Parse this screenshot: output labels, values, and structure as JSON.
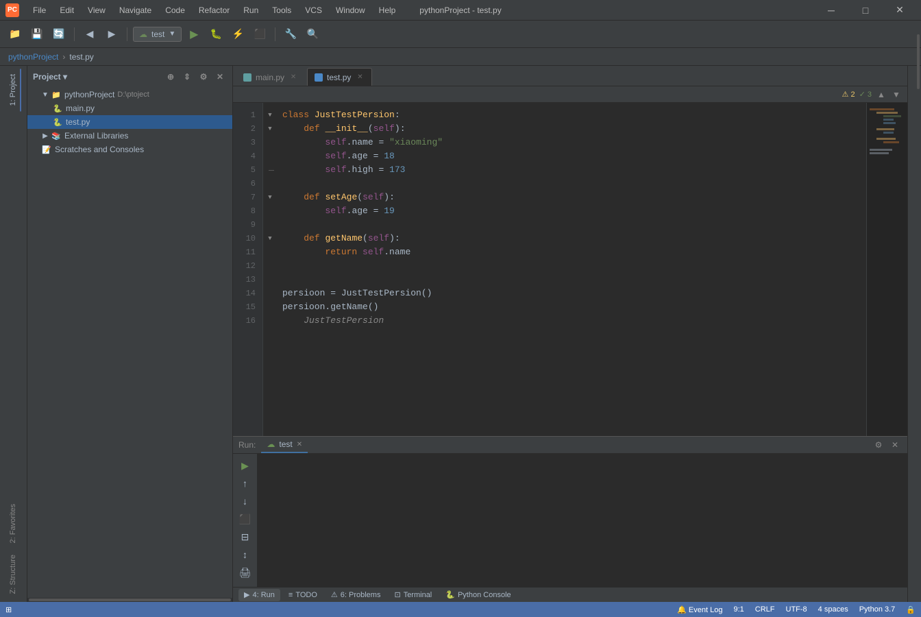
{
  "titleBar": {
    "logo": "PC",
    "title": "pythonProject - test.py",
    "menus": [
      "File",
      "Edit",
      "View",
      "Navigate",
      "Code",
      "Refactor",
      "Run",
      "Tools",
      "VCS",
      "Window",
      "Help"
    ],
    "minimize": "─",
    "maximize": "□",
    "close": "✕"
  },
  "toolbar": {
    "runConfig": "test",
    "buttons": [
      "folder",
      "save",
      "refresh",
      "back",
      "forward",
      "run",
      "debug",
      "coverage",
      "stop",
      "wrench",
      "search"
    ]
  },
  "breadcrumb": {
    "project": "pythonProject",
    "file": "test.py"
  },
  "sidebar": {
    "title": "Project",
    "items": [
      {
        "label": "pythonProject",
        "path": "D:\\ptoject",
        "type": "folder",
        "expanded": true
      },
      {
        "label": "main.py",
        "type": "python",
        "indent": 2
      },
      {
        "label": "test.py",
        "type": "python",
        "indent": 2,
        "selected": true
      },
      {
        "label": "External Libraries",
        "type": "folder",
        "indent": 1
      },
      {
        "label": "Scratches and Consoles",
        "type": "scratch",
        "indent": 1
      }
    ]
  },
  "tabs": [
    {
      "label": "main.py",
      "active": false
    },
    {
      "label": "test.py",
      "active": true
    }
  ],
  "editor": {
    "warningCount": "2",
    "okCount": "3",
    "lines": [
      {
        "num": 1,
        "content": "class JustTestPersion:"
      },
      {
        "num": 2,
        "content": "    def __init__(self):"
      },
      {
        "num": 3,
        "content": "        self.name = \"xiaoming\""
      },
      {
        "num": 4,
        "content": "        self.age = 18"
      },
      {
        "num": 5,
        "content": "        self.high = 173"
      },
      {
        "num": 6,
        "content": ""
      },
      {
        "num": 7,
        "content": "    def setAge(self):"
      },
      {
        "num": 8,
        "content": "        self.age = 19"
      },
      {
        "num": 9,
        "content": ""
      },
      {
        "num": 10,
        "content": "    def getName(self):"
      },
      {
        "num": 11,
        "content": "        return self.name"
      },
      {
        "num": 12,
        "content": ""
      },
      {
        "num": 13,
        "content": ""
      },
      {
        "num": 14,
        "content": "persioon = JustTestPersion()"
      },
      {
        "num": 15,
        "content": "persioon.getName()"
      },
      {
        "num": 16,
        "content": ""
      }
    ],
    "ghostText": "JustTestPersion"
  },
  "runPanel": {
    "label": "Run:",
    "tabLabel": "test",
    "output": ""
  },
  "bottomTabs": [
    {
      "label": "4: Run",
      "icon": "▶",
      "active": true
    },
    {
      "label": "TODO",
      "icon": "≡"
    },
    {
      "label": "6: Problems",
      "icon": "⚠",
      "badge": "6"
    },
    {
      "label": "Terminal",
      "icon": "⊡"
    },
    {
      "label": "Python Console",
      "icon": "🐍"
    }
  ],
  "statusBar": {
    "position": "9:1",
    "lineEnding": "CRLF",
    "encoding": "UTF-8",
    "indent": "4 spaces",
    "pythonVersion": "Python 3.7",
    "rightIcon": "🔒",
    "eventLog": "Event Log"
  },
  "leftPanelTabs": [
    {
      "label": "1: Project",
      "active": true
    },
    {
      "label": "2: Favorites"
    },
    {
      "label": "Z: Structure"
    }
  ]
}
